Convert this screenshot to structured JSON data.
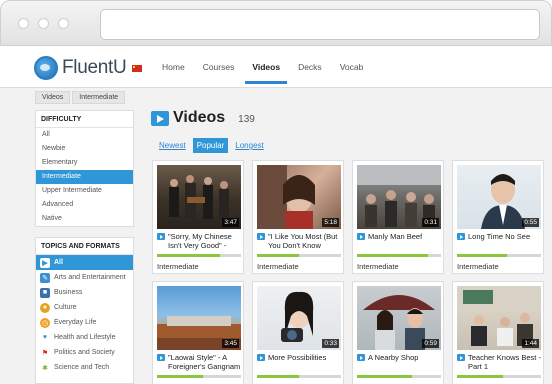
{
  "app": {
    "name": "FluentU"
  },
  "nav": [
    {
      "label": "Home",
      "active": false
    },
    {
      "label": "Courses",
      "active": false
    },
    {
      "label": "Videos",
      "active": true
    },
    {
      "label": "Decks",
      "active": false
    },
    {
      "label": "Vocab",
      "active": false
    }
  ],
  "breadcrumb": [
    "Videos",
    "Intermediate"
  ],
  "difficulty": {
    "title": "DIFFICULTY",
    "items": [
      {
        "label": "All",
        "active": false
      },
      {
        "label": "Newbie",
        "active": false
      },
      {
        "label": "Elementary",
        "active": false
      },
      {
        "label": "Intermediate",
        "active": true
      },
      {
        "label": "Upper Intermediate",
        "active": false
      },
      {
        "label": "Advanced",
        "active": false
      },
      {
        "label": "Native",
        "active": false
      }
    ]
  },
  "topics": {
    "title": "TOPICS AND FORMATS",
    "items": [
      {
        "label": "All",
        "icon": "film-icon",
        "active": true
      },
      {
        "label": "Arts and Entertainment",
        "icon": "palette-icon",
        "active": false
      },
      {
        "label": "Business",
        "icon": "briefcase-icon",
        "active": false
      },
      {
        "label": "Culture",
        "icon": "globe-icon",
        "active": false
      },
      {
        "label": "Everyday Life",
        "icon": "clock-icon",
        "active": false
      },
      {
        "label": "Health and Lifestyle",
        "icon": "heart-icon",
        "active": false
      },
      {
        "label": "Politics and Society",
        "icon": "flag-icon",
        "active": false
      },
      {
        "label": "Science and Tech",
        "icon": "molecule-icon",
        "active": false
      }
    ]
  },
  "main": {
    "title": "Videos",
    "count": "139",
    "sort_tabs": [
      {
        "label": "Newest",
        "active": false
      },
      {
        "label": "Popular",
        "active": true
      },
      {
        "label": "Longest",
        "active": false
      }
    ]
  },
  "videos": [
    {
      "title": "\"Sorry, My Chinese Isn't Very Good\" -",
      "duration": "3:47",
      "level": "Intermediate",
      "progress": 0.75
    },
    {
      "title": "\"I Like You Most (But You Don't Know",
      "duration": "5:18",
      "level": "Intermediate",
      "progress": 0.5
    },
    {
      "title": "Manly Man Beef",
      "duration": "0:31",
      "level": "Intermediate",
      "progress": 0.85
    },
    {
      "title": "Long Time No See",
      "duration": "0:55",
      "level": "Intermediate",
      "progress": 0.6
    },
    {
      "title": "\"Laowai Style\" - A Foreigner's Gangnam",
      "duration": "3:45",
      "level": "",
      "progress": 0.55
    },
    {
      "title": "More Possibilities",
      "duration": "0:33",
      "level": "",
      "progress": 0.5
    },
    {
      "title": "A Nearby Shop",
      "duration": "0:59",
      "level": "",
      "progress": 0.65
    },
    {
      "title": "Teacher Knows Best - Part 1",
      "duration": "1:44",
      "level": "",
      "progress": 0.55
    }
  ],
  "colors": {
    "accent": "#2f96d8",
    "progress": "#8cc63f",
    "flag": "#d52b1e"
  }
}
